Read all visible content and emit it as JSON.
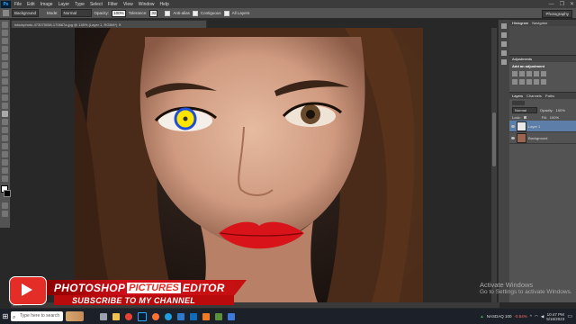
{
  "app": {
    "logo_text": "Ps"
  },
  "menu": [
    "File",
    "Edit",
    "Image",
    "Layer",
    "Type",
    "Select",
    "Filter",
    "View",
    "Window",
    "Help"
  ],
  "window_controls": [
    "—",
    "❐",
    "✕"
  ],
  "options_bar": {
    "sample_label": "Sample:",
    "sample_value": "Background",
    "mode_label": "Mode:",
    "mode_value": "Normal",
    "opacity_label": "Opacity:",
    "opacity_value": "100%",
    "tolerance_label": "Tolerance:",
    "tolerance_value": "32",
    "antialias": "Anti-alias",
    "contiguous": "Contiguous",
    "all_layers": "All Layers",
    "workspace": "Photography"
  },
  "document_tab": "istockphoto-473075058-170667a.jpg @ 145% (Layer 1, RGB/8*) ✕",
  "status": "145%",
  "panels": {
    "histogram_tabs": [
      "Histogram",
      "Navigator"
    ],
    "adjustments_tab": "Adjustments",
    "adjustments_title": "Add an adjustment",
    "layers_tabs": [
      "Layers",
      "Channels",
      "Paths"
    ],
    "blend_mode": "Normal",
    "opacity_label": "Opacity:",
    "opacity_value": "100%",
    "lock_label": "Lock:",
    "fill_label": "Fill:",
    "fill_value": "100%",
    "layers": [
      {
        "name": "Layer 1",
        "selected": true
      },
      {
        "name": "Background",
        "selected": false
      }
    ]
  },
  "branding": {
    "title_part1": "PHOTOSHOP",
    "title_part2": "PICTURES",
    "title_part3": "EDITOR",
    "subscribe": "SUBSCRIBE TO MY CHANNEL"
  },
  "watermark": {
    "line1": "Activate Windows",
    "line2": "Go to Settings to activate Windows."
  },
  "taskbar": {
    "search_placeholder": "Type here to search",
    "ticker": "NASDAQ 100",
    "ticker_change": "-0.54%",
    "time": "10:47 PM",
    "date": "5/16/2023"
  },
  "colors": {
    "accent": "#31a8ff",
    "brand_red": "#d10f1a",
    "eye_fill": "#ffe600",
    "brush_ring": "#1e4fd6",
    "lips": "#d8141a"
  }
}
